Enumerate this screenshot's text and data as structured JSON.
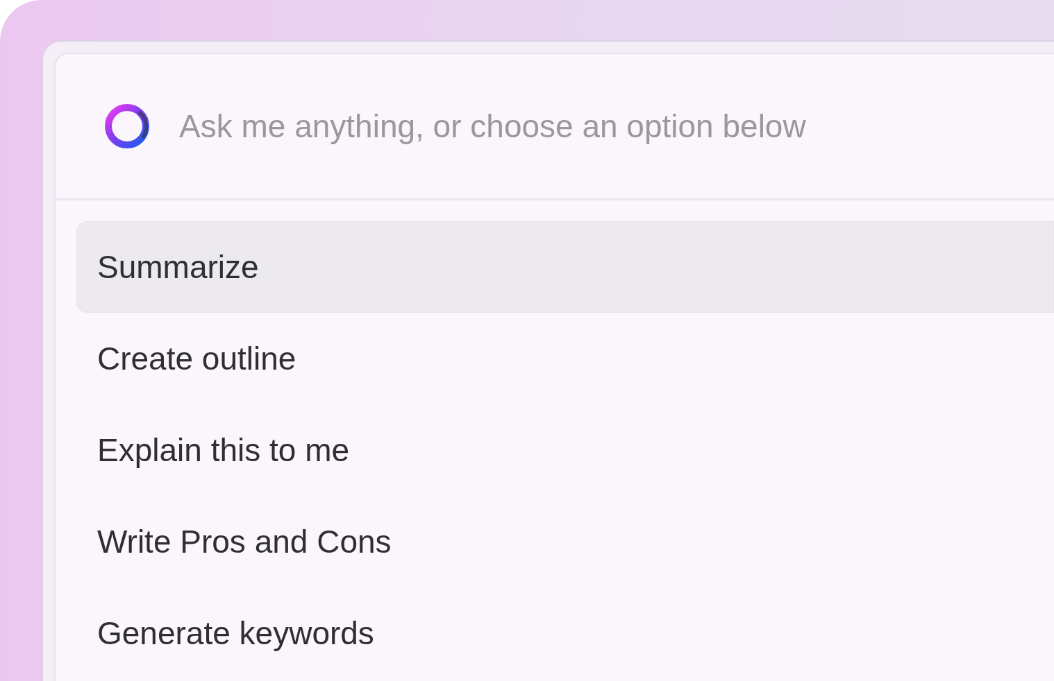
{
  "search": {
    "placeholder": "Ask me anything, or choose an option below"
  },
  "options": [
    {
      "label": "Summarize",
      "selected": true
    },
    {
      "label": "Create outline",
      "selected": false
    },
    {
      "label": "Explain this to me",
      "selected": false
    },
    {
      "label": "Write Pros and Cons",
      "selected": false
    },
    {
      "label": "Generate keywords",
      "selected": false
    }
  ]
}
